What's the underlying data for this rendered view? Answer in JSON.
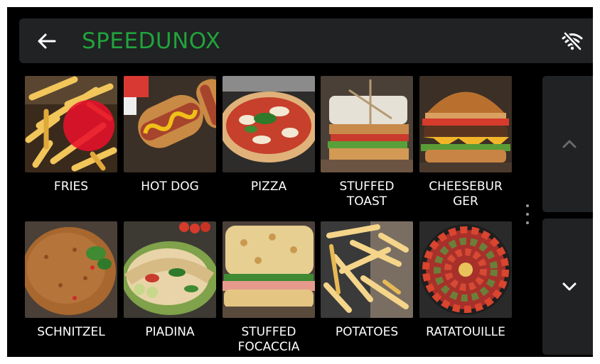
{
  "header": {
    "title": "SPEEDUNOX",
    "back_icon": "arrow-left-icon",
    "status_icon": "wifi-off-icon"
  },
  "colors": {
    "title": "#21a33c",
    "header_bg": "#202223",
    "screen_bg": "#000000",
    "touch_indicator": "#e8102a"
  },
  "grid": {
    "items": [
      {
        "label": "FRIES"
      },
      {
        "label": "HOT DOG"
      },
      {
        "label": "PIZZA"
      },
      {
        "label": "STUFFED\nTOAST"
      },
      {
        "label": "CHEESEBUR\nGER"
      },
      {
        "label": "SCHNITZEL"
      },
      {
        "label": "PIADINA"
      },
      {
        "label": "STUFFED\nFOCACCIA"
      },
      {
        "label": "POTATOES"
      },
      {
        "label": "RATATOUILLE"
      }
    ]
  },
  "scroll": {
    "up_icon": "chevron-up-icon",
    "down_icon": "chevron-down-icon"
  }
}
